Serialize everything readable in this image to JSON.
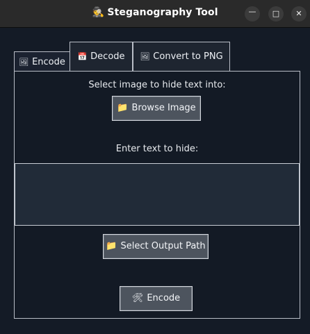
{
  "window": {
    "title": "Steganography Tool",
    "title_icon": "🕵",
    "controls": {
      "minimize": "—",
      "maximize": "□",
      "close": "✕"
    }
  },
  "tabs": [
    {
      "label": "Encode",
      "icon": "🖼",
      "active": true
    },
    {
      "label": "Decode",
      "icon": "📅",
      "active": false
    },
    {
      "label": "Convert to PNG",
      "icon": "🖼",
      "active": false
    }
  ],
  "encode": {
    "select_image_label": "Select image to hide text into:",
    "browse_button": {
      "icon": "📁",
      "label": "Browse Image"
    },
    "enter_text_label": "Enter text to hide:",
    "text_value": "",
    "output_button": {
      "icon": "📁",
      "label": "Select Output Path"
    },
    "encode_button": {
      "icon": "🛠",
      "label": "Encode"
    }
  },
  "colors": {
    "background": "#141b26",
    "titlebar": "#2a2a2a",
    "button": "#4d545e",
    "textarea": "#212b38",
    "border": "#b9bec7"
  }
}
